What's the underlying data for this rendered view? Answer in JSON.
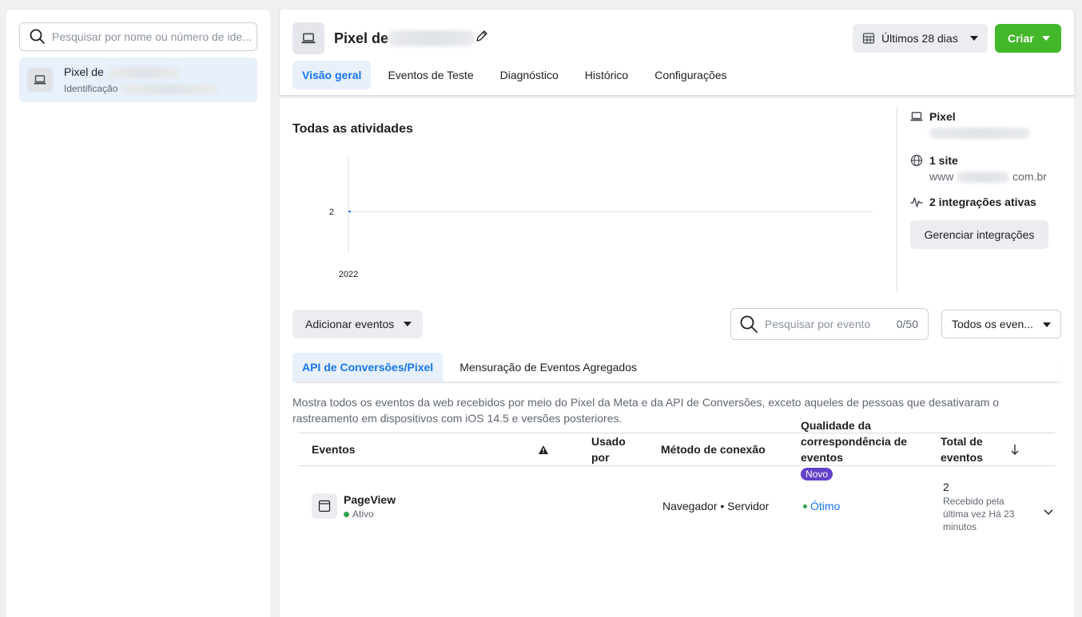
{
  "sidebar": {
    "search_placeholder": "Pesquisar por nome ou número de ide...",
    "item": {
      "name": "Pixel de",
      "id_label": "Identificação"
    }
  },
  "header": {
    "title": "Pixel de",
    "date_range": "Últimos 28 dias",
    "create_label": "Criar",
    "tabs": [
      "Visão geral",
      "Eventos de Teste",
      "Diagnóstico",
      "Histórico",
      "Configurações"
    ]
  },
  "activity": {
    "title": "Todas as atividades"
  },
  "chart_data": {
    "type": "line",
    "x": [
      "2022"
    ],
    "series": [
      {
        "values": [
          2
        ]
      }
    ],
    "yticks": [
      "2"
    ],
    "xticks": [
      "2022"
    ],
    "title": "Todas as atividades"
  },
  "side_info": {
    "pixel_label": "Pixel",
    "site_count": "1 site",
    "site_url_prefix": "www",
    "site_url_suffix": "com.br",
    "integrations": "2 integrações ativas",
    "manage_label": "Gerenciar integrações"
  },
  "events_toolbar": {
    "add_label": "Adicionar eventos",
    "search_placeholder": "Pesquisar por evento",
    "search_count": "0/50",
    "filter_label": "Todos os even..."
  },
  "sub_tabs": [
    "API de Conversões/Pixel",
    "Mensuração de Eventos Agregados"
  ],
  "description": "Mostra todos os eventos da web recebidos por meio do Pixel da Meta e da API de Conversões, exceto aqueles de pessoas que desativaram o rastreamento em dispositivos com iOS 14.5 e versões posteriores.",
  "table": {
    "headers": {
      "events": "Eventos",
      "used_by": "Usado por",
      "method": "Método de conexão",
      "quality": "Qualidade da correspondência de eventos",
      "total": "Total de eventos"
    },
    "rows": [
      {
        "name": "PageView",
        "status": "Ativo",
        "method": "Navegador • Servidor",
        "badge": "Novo",
        "quality": "Ótimo",
        "total": "2",
        "last_received": "Recebido pela última vez Há 23 minutos"
      }
    ]
  },
  "colors": {
    "accent": "#1877f2",
    "create": "#42b72a",
    "badge": "#6441c8",
    "active_bg": "#e7f0fb"
  }
}
